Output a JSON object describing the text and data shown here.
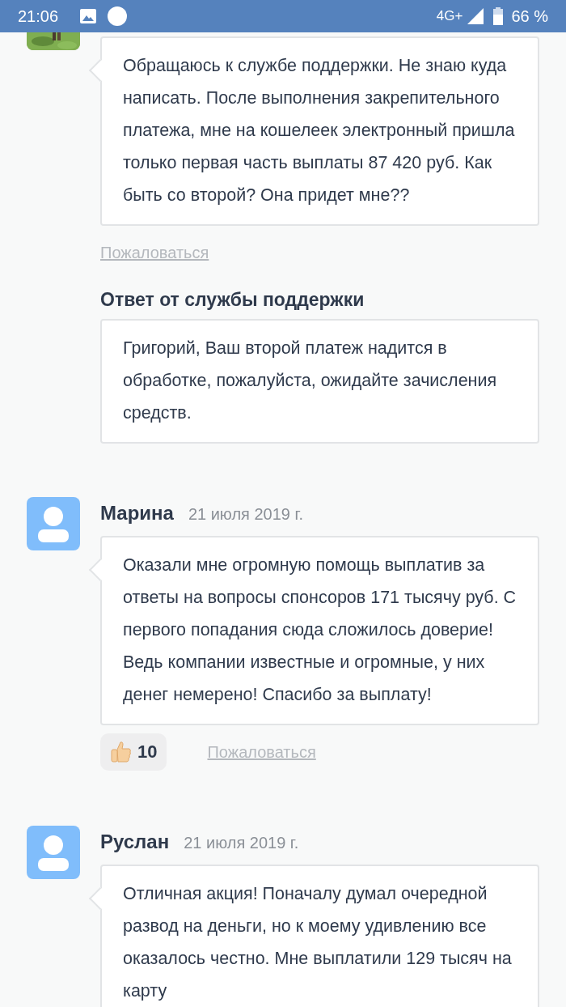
{
  "status_bar": {
    "time": "21:06",
    "network": "4G+",
    "battery": "66 %"
  },
  "comments": [
    {
      "kind": "picture",
      "text": "Обращаюсь к службе поддержки. Не знаю куда написать. После выполнения закрепительного платежа, мне на кошелеек электронный пришла только первая часть выплаты 87 420 руб. Как быть со второй? Она придет мне??",
      "report": "Пожаловаться",
      "reply": {
        "title": "Ответ от службы поддержки",
        "text": "Григорий, Ваш второй платеж надится в обработке, пожалуйста, ожидайте зачисления средств."
      }
    },
    {
      "kind": "default",
      "name": "Марина",
      "date": "21 июля 2019 г.",
      "text": "Оказали мне огромную помощь выплатив за ответы на вопросы спонсоров 171 тысячу руб. С первого попадания сюда сложилось доверие! Ведь компании известные и огромные, у них денег немерено! Спасибо за выплату!",
      "likes": "10",
      "report": "Пожаловаться"
    },
    {
      "kind": "default",
      "name": "Руслан",
      "date": "21 июля 2019 г.",
      "text": "Отличная акция! Поначалу думал очередной развод на деньги, но к моему удивлению все оказалось честно. Мне выплатили 129 тысяч на карту"
    }
  ]
}
